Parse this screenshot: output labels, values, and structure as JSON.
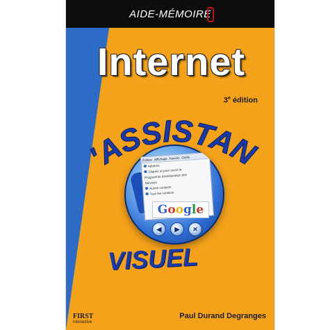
{
  "cover": {
    "series": "AIDE-MÉMOIRE",
    "title": "Internet",
    "edition": {
      "number": "3",
      "suffix": "e",
      "word": "édition"
    },
    "arc_title": "L'ASSISTANT",
    "bottom_title": "VISUEL",
    "author": "Paul Durand Degranges",
    "publisher": {
      "name": "FIRST",
      "sub": "interactive"
    },
    "screen": {
      "menu": [
        "Édition",
        "Affichage",
        "Favoris",
        "Outils"
      ],
      "rows": [
        "Adhérez",
        "Cliquez ici pour ouvrir le",
        "Programme d'amélioration des",
        "Services",
        "Autres contacts",
        "Tous les contacts"
      ]
    },
    "google_logo": [
      "G",
      "o",
      "o",
      "g",
      "l",
      "e"
    ],
    "nav_buttons": [
      "◀",
      "▶",
      "✕"
    ]
  },
  "colors": {
    "background": "#f4a21a",
    "series_bar": "#0d0d0d",
    "title_blue": "#1a3aa8",
    "globe_blue": "#2f6fd6"
  }
}
